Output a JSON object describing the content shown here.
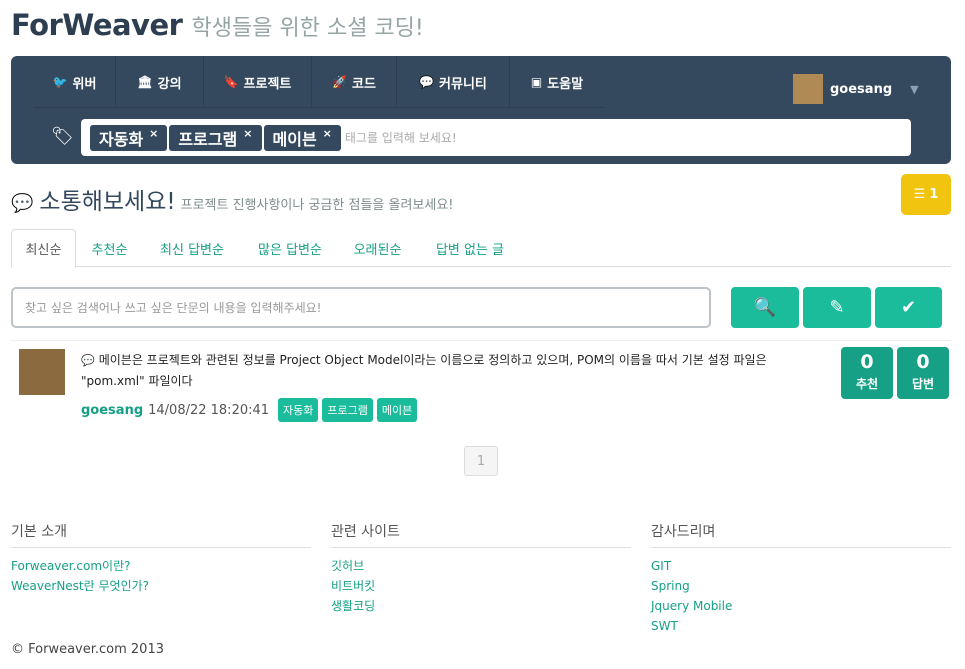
{
  "brand": {
    "name": "ForWeaver",
    "subtitle": "학생들을 위한 소셜 코딩!"
  },
  "nav": {
    "items": [
      {
        "icon": "twitter-icon",
        "glyph": "🐦",
        "label": "위버"
      },
      {
        "icon": "university-icon",
        "glyph": "🏛",
        "label": "강의"
      },
      {
        "icon": "bookmark-icon",
        "glyph": "🔖",
        "label": "프로젝트"
      },
      {
        "icon": "rocket-icon",
        "glyph": "🚀",
        "label": "코드"
      },
      {
        "icon": "comments-icon",
        "glyph": "💬",
        "label": "커뮤니티"
      },
      {
        "icon": "help-icon",
        "glyph": "▣",
        "label": "도움말"
      }
    ],
    "user": {
      "name": "goesang"
    }
  },
  "tag_filter": {
    "tags": [
      "자동화",
      "프로그램",
      "메이븐"
    ],
    "remove_glyph": "×",
    "placeholder": "태그를 입력해 보세요!"
  },
  "section": {
    "title": "소통해보세요!",
    "subtitle": "프로젝트 진행사항이나 궁금한 점들을 올려보세요!",
    "coin_count": "1"
  },
  "tabs": [
    "최신순",
    "추천순",
    "최신 답변순",
    "많은 답변순",
    "오래된순",
    "답변 없는 글"
  ],
  "search": {
    "placeholder": "찾고 싶은 검색어나 쓰고 싶은 단문의 내용을 입력해주세요!"
  },
  "post": {
    "text": "메이븐은 프로젝트와 관련된 정보를 Project Object Model이라는 이름으로 정의하고 있으며, POM의 이름을 따서 기본 설정 파일은 \"pom.xml\" 파일이다",
    "author": "goesang",
    "date": "14/08/22 18:20:41",
    "tags": [
      "자동화",
      "프로그램",
      "메이븐"
    ],
    "recommend": {
      "count": "0",
      "label": "추천"
    },
    "answers": {
      "count": "0",
      "label": "답변"
    }
  },
  "pagination": {
    "current": "1"
  },
  "footer": {
    "columns": [
      {
        "title": "기본 소개",
        "links": [
          "Forweaver.com이란?",
          "WeaverNest란 무엇인가?"
        ]
      },
      {
        "title": "관련 사이트",
        "links": [
          "깃허브",
          "비트버킷",
          "생활코딩"
        ]
      },
      {
        "title": "감사드리며",
        "links": [
          "GIT",
          "Spring",
          "Jquery Mobile",
          "SWT"
        ]
      }
    ],
    "copyright": "© Forweaver.com 2013"
  },
  "colors": {
    "navbar": "#34495e",
    "accent": "#1abc9c",
    "accent_dark": "#16a085",
    "coin": "#f1c40f"
  }
}
